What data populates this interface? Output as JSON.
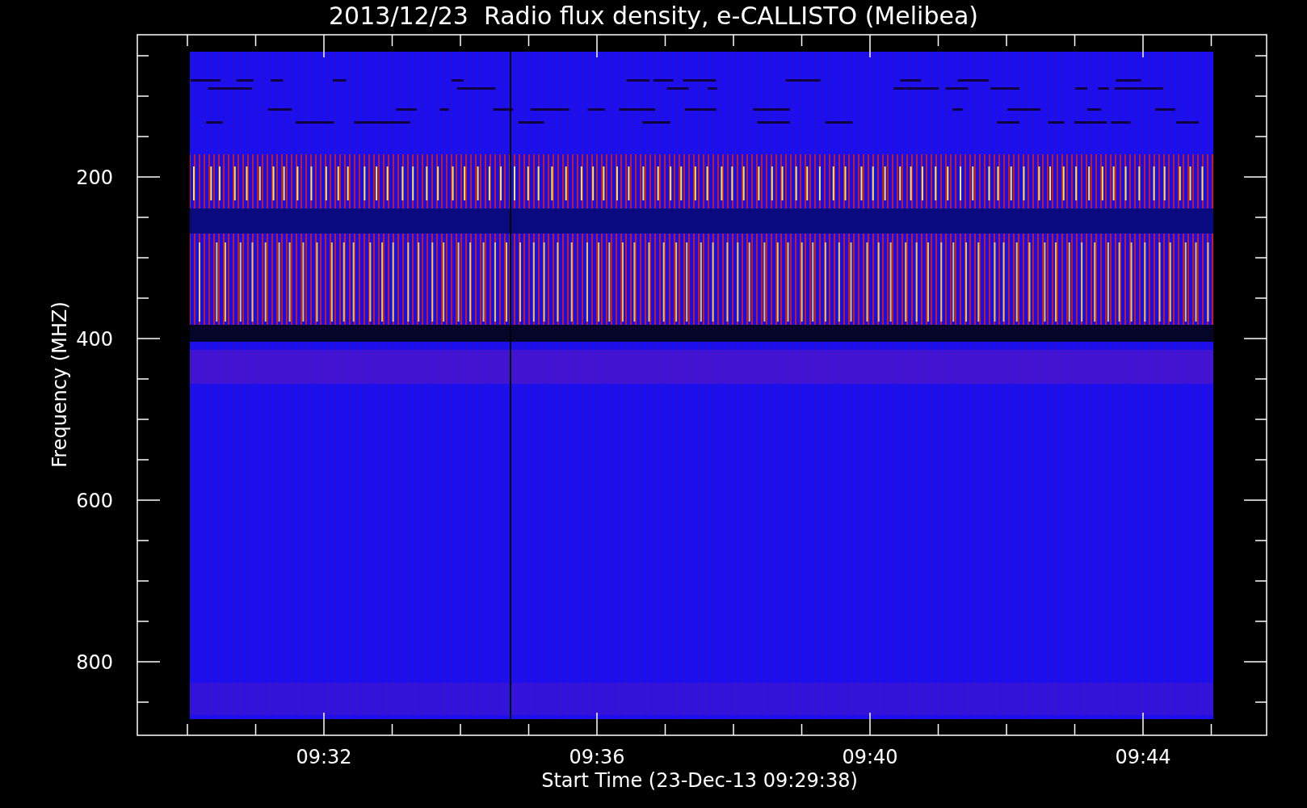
{
  "title": "2013/12/23  Radio flux density, e-CALLISTO (Melibea)",
  "y_axis": {
    "label": "Frequency (MHZ)",
    "ticks": [
      "200",
      "400",
      "600",
      "800"
    ]
  },
  "x_axis": {
    "label": "Start Time (23-Dec-13 09:29:38)",
    "ticks": [
      "09:32",
      "09:36",
      "09:40",
      "09:44"
    ]
  }
}
